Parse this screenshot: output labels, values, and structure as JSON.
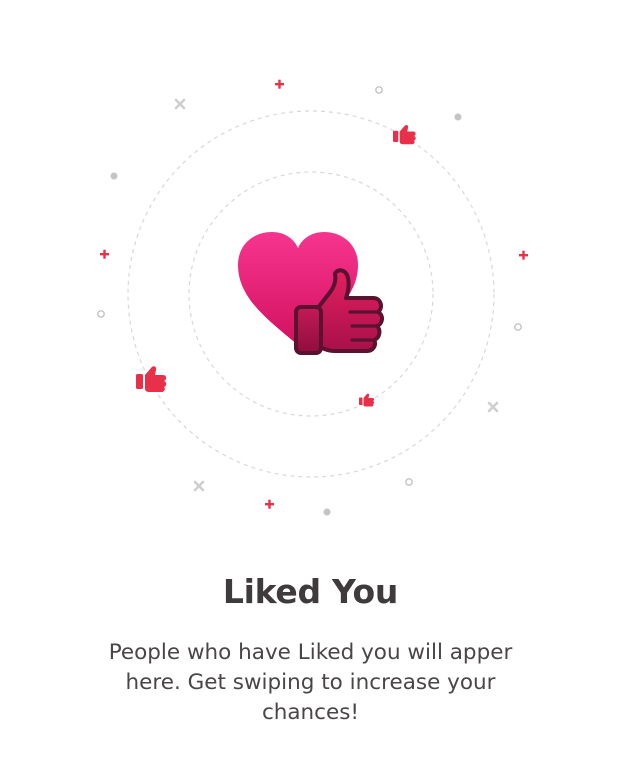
{
  "empty_state": {
    "title": "Liked You",
    "message": "People who have Liked you will apper here. Get swiping to increase your chances!"
  },
  "colors": {
    "accent_red": "#e8304a",
    "heart_gradient_top": "#f7358f",
    "heart_gradient_bottom": "#d3115f",
    "thumb_gradient_top": "#e3205f",
    "thumb_gradient_bottom": "#a8104a",
    "thumb_outline": "#5a1230",
    "decor_gray": "#c8c8c8",
    "title_text": "#3f3b3d",
    "body_text": "#4a4648"
  },
  "icons": {
    "main": "heart-with-thumbs-up-icon",
    "decorations": [
      "plus-icon",
      "cross-icon",
      "dot-icon",
      "ring-icon",
      "thumbs-up-icon"
    ]
  }
}
